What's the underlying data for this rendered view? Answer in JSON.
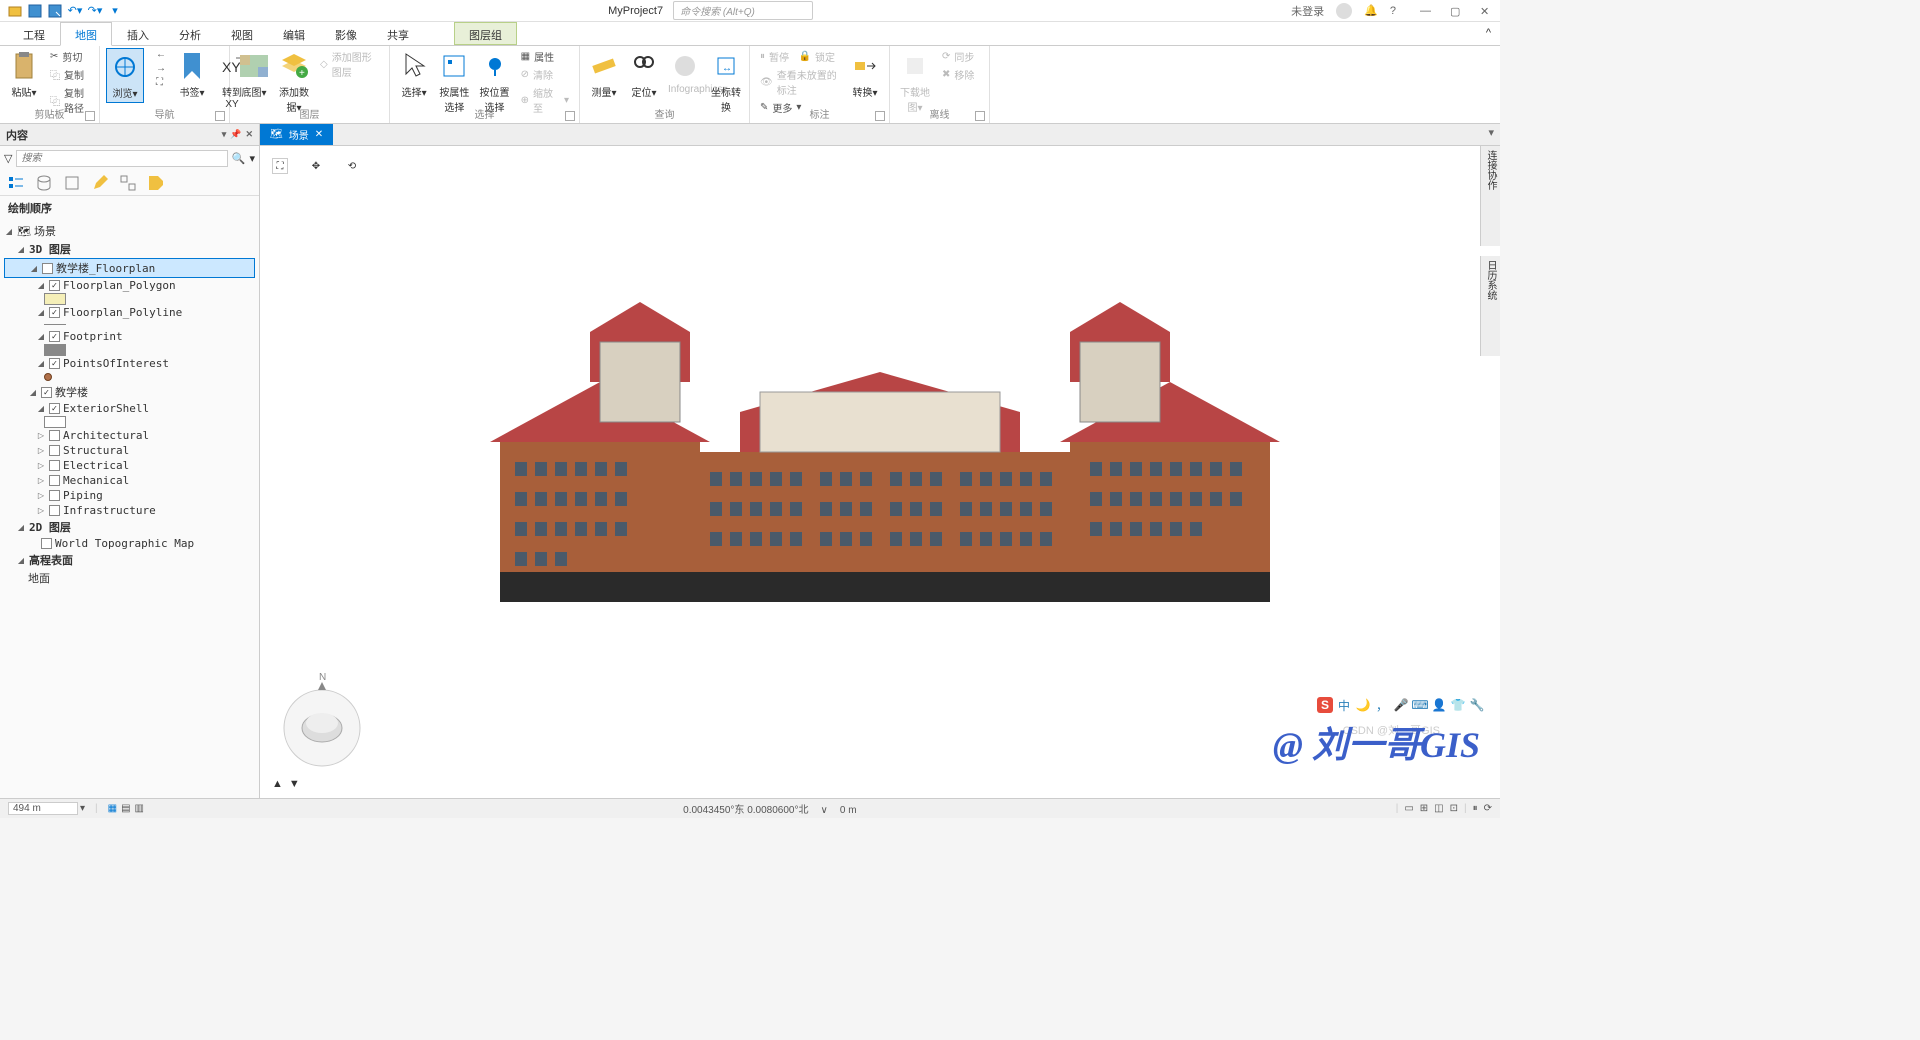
{
  "title": {
    "project": "MyProject7",
    "search_placeholder": "命令搜索 (Alt+Q)",
    "login_status": "未登录"
  },
  "tabs": {
    "t1": "工程",
    "t2": "地图",
    "t3": "插入",
    "t4": "分析",
    "t5": "视图",
    "t6": "编辑",
    "t7": "影像",
    "t8": "共享",
    "t9": "图层组"
  },
  "ribbon": {
    "clipboard": {
      "label": "剪贴板",
      "paste": "粘贴",
      "cut": "剪切",
      "copy": "复制",
      "copypath": "复制路径"
    },
    "nav": {
      "label": "导航",
      "browse": "浏览",
      "bookmark": "书签",
      "goto": "转到XY"
    },
    "layer": {
      "label": "图层",
      "basemap": "底图",
      "adddata": "添加数据",
      "addgraphic": "添加图形图层"
    },
    "select": {
      "label": "选择",
      "select": "选择",
      "byattr": "按属性选择",
      "byloc": "按位置选择",
      "attr": "属性",
      "clear": "清除",
      "zoomto": "缩放至"
    },
    "query": {
      "label": "查询",
      "measure": "测量",
      "locate": "定位",
      "info": "Infographics",
      "coord": "坐标转换"
    },
    "annotate": {
      "label": "标注",
      "pause": "暂停",
      "lock": "锁定",
      "unplaced": "查看未放置的标注",
      "more": "更多",
      "convert": "转换"
    },
    "offline": {
      "label": "离线",
      "download": "下载地图",
      "sync": "同步",
      "remove": "移除"
    }
  },
  "contents": {
    "title": "内容",
    "search_placeholder": "搜索",
    "section": "绘制顺序",
    "scene": "场景",
    "layers3d": "3D 图层",
    "floorplan": "教学楼_Floorplan",
    "floorplan_polygon": "Floorplan_Polygon",
    "floorplan_polyline": "Floorplan_Polyline",
    "footprint": "Footprint",
    "poi": "PointsOfInterest",
    "building": "教学楼",
    "exterior": "ExteriorShell",
    "arch": "Architectural",
    "struct": "Structural",
    "elec": "Electrical",
    "mech": "Mechanical",
    "piping": "Piping",
    "infra": "Infrastructure",
    "layers2d": "2D 图层",
    "topo": "World Topographic Map",
    "elevation": "高程表面",
    "ground": "地面"
  },
  "view": {
    "tab": "场景"
  },
  "status": {
    "scale": "494 m",
    "coords": "0.0043450°东 0.0080600°北",
    "elev": "0 m"
  },
  "watermark": "@ 刘一哥GIS",
  "watermark2": "CSDN @刘一哥GIS",
  "side": {
    "s1": "连接协作",
    "s2": "日历系统"
  }
}
